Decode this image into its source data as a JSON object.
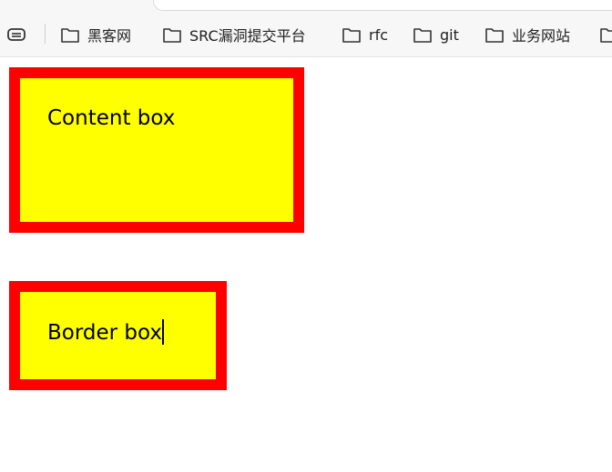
{
  "bookmarks_bar": {
    "items": [
      {
        "label": "黑客网",
        "icon": "folder-icon"
      },
      {
        "label": "SRC漏洞提交平台",
        "icon": "folder-icon"
      },
      {
        "label": "rfc",
        "icon": "folder-icon"
      },
      {
        "label": "git",
        "icon": "folder-icon"
      },
      {
        "label": "业务网站",
        "icon": "folder-icon"
      }
    ],
    "leading_icon": "tab-search-icon"
  },
  "page": {
    "content_box_text": "Content box",
    "border_box_text": "Border box"
  },
  "colors": {
    "box_border": "#ff0000",
    "box_background": "#ffff00",
    "text": "#000000"
  }
}
